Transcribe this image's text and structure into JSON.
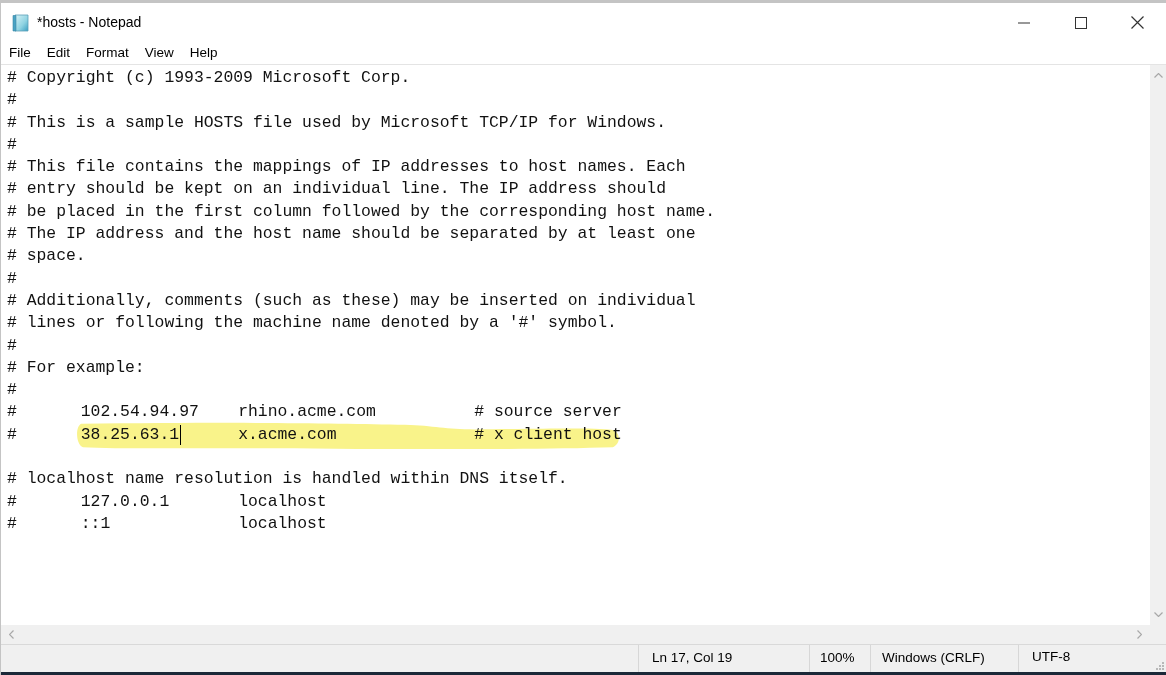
{
  "window": {
    "title": "*hosts - Notepad"
  },
  "menu": [
    "File",
    "Edit",
    "Format",
    "View",
    "Help"
  ],
  "editor": {
    "lines": [
      {
        "kind": "text",
        "text": "# Copyright (c) 1993-2009 Microsoft Corp."
      },
      {
        "kind": "text",
        "text": "#"
      },
      {
        "kind": "text",
        "text": "# This is a sample HOSTS file used by Microsoft TCP/IP for Windows."
      },
      {
        "kind": "text",
        "text": "#"
      },
      {
        "kind": "text",
        "text": "# This file contains the mappings of IP addresses to host names. Each"
      },
      {
        "kind": "text",
        "text": "# entry should be kept on an individual line. The IP address should"
      },
      {
        "kind": "text",
        "text": "# be placed in the first column followed by the corresponding host name."
      },
      {
        "kind": "text",
        "text": "# The IP address and the host name should be separated by at least one"
      },
      {
        "kind": "text",
        "text": "# space."
      },
      {
        "kind": "text",
        "text": "#"
      },
      {
        "kind": "text",
        "text": "# Additionally, comments (such as these) may be inserted on individual"
      },
      {
        "kind": "text",
        "text": "# lines or following the machine name denoted by a '#' symbol."
      },
      {
        "kind": "text",
        "text": "#"
      },
      {
        "kind": "text",
        "text": "# For example:"
      },
      {
        "kind": "text",
        "text": "#"
      },
      {
        "kind": "entry",
        "highlighted": false,
        "cells": [
          {
            "text": "#",
            "caret": false
          },
          {
            "text": "102.54.94.97",
            "caret": false
          },
          {
            "text": "rhino.acme.com",
            "caret": false
          },
          {
            "text": "# source server",
            "caret": false
          }
        ]
      },
      {
        "kind": "entry",
        "highlighted": true,
        "cells": [
          {
            "text": "#",
            "caret": false
          },
          {
            "text": "38.25.63.1",
            "caret": true
          },
          {
            "text": "x.acme.com",
            "caret": false
          },
          {
            "text": "# x client host",
            "caret": false
          }
        ]
      },
      {
        "kind": "blank"
      },
      {
        "kind": "text",
        "text": "# localhost name resolution is handled within DNS itself."
      },
      {
        "kind": "entry",
        "highlighted": false,
        "cells": [
          {
            "text": "#",
            "caret": false
          },
          {
            "text": "127.0.0.1",
            "caret": false
          },
          {
            "text": "localhost",
            "caret": false
          }
        ]
      },
      {
        "kind": "entry",
        "highlighted": false,
        "cells": [
          {
            "text": "#",
            "caret": false
          },
          {
            "text": "::1",
            "caret": false
          },
          {
            "text": "localhost",
            "caret": false
          }
        ]
      }
    ]
  },
  "status_bar": {
    "position": "Ln 17, Col 19",
    "zoom": "100%",
    "line_ending": "Windows (CRLF)",
    "encoding": "UTF-8"
  }
}
